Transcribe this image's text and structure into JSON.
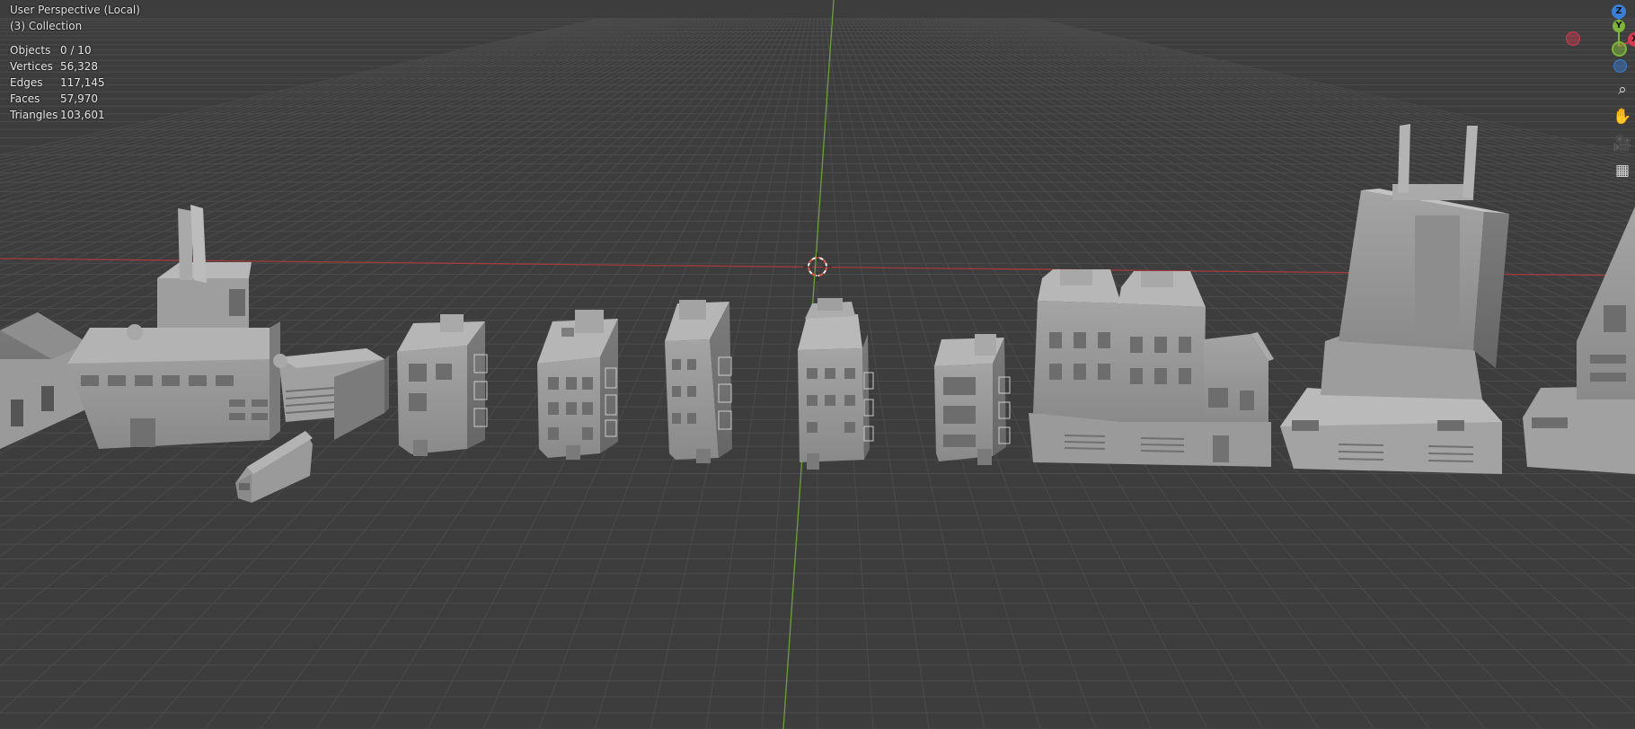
{
  "viewport": {
    "view_name": "User Perspective (Local)",
    "collection": "(3) Collection"
  },
  "stats": [
    {
      "label": "Objects",
      "value": "0 / 10"
    },
    {
      "label": "Vertices",
      "value": "56,328"
    },
    {
      "label": "Edges",
      "value": "117,145"
    },
    {
      "label": "Faces",
      "value": "57,970"
    },
    {
      "label": "Triangles",
      "value": "103,601"
    }
  ],
  "gizmo": {
    "z_label": "Z",
    "y_label": "Y",
    "x_label": "X",
    "colors": {
      "x": "#d3394f",
      "y": "#7eb43a",
      "z": "#3a7fd6"
    }
  },
  "nav_tools": [
    {
      "name": "zoom-icon",
      "glyph": "⌕"
    },
    {
      "name": "pan-hand-icon",
      "glyph": "✋"
    },
    {
      "name": "camera-icon",
      "glyph": "🎥"
    },
    {
      "name": "grid-view-icon",
      "glyph": "▦"
    }
  ],
  "colors": {
    "background": "#3d3d3d",
    "grid": "#4a4a4a",
    "x_axis": "#b34242",
    "y_axis": "#6ea83a",
    "building": "#9a9a9a"
  }
}
